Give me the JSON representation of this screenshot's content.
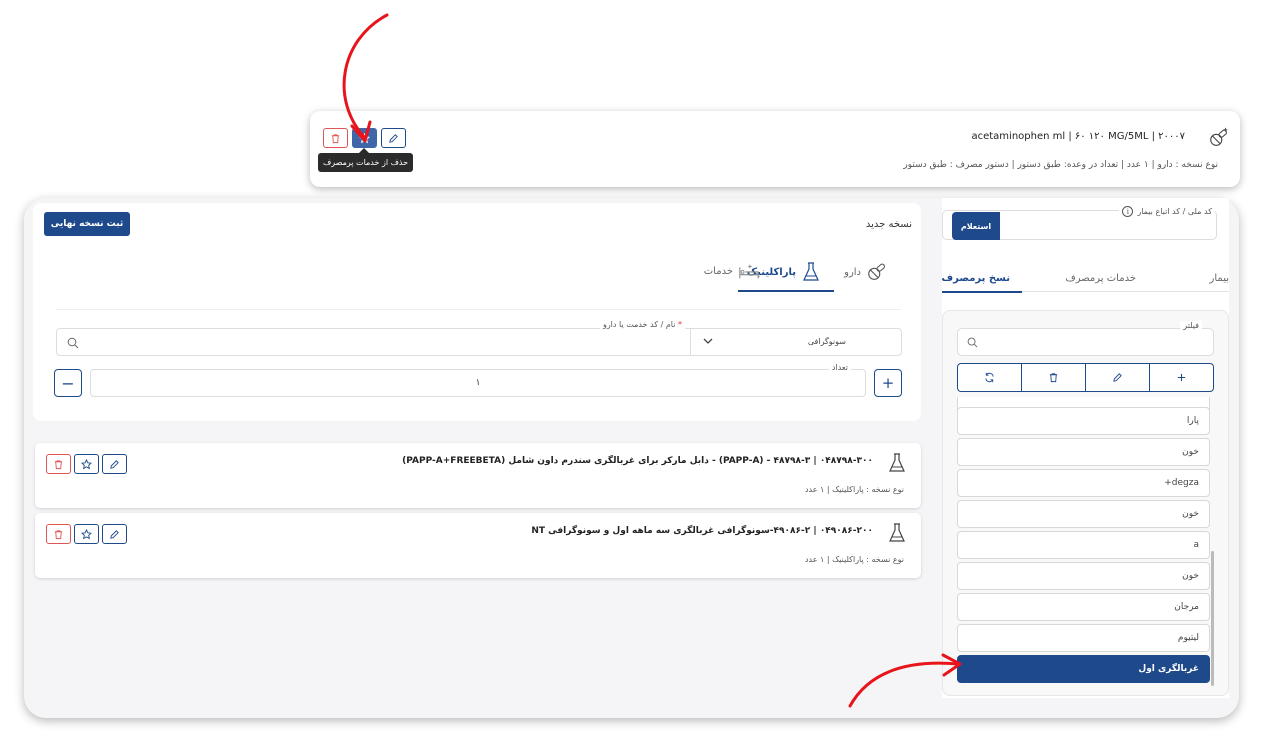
{
  "top_card": {
    "line1": "۲۰۰۰۷ | acetaminophen ml | ۶۰ ۱۲۰ MG/5ML",
    "line2": "نوع نسخه : دارو  |  ۱ عدد  |  تعداد در وعده: طبق دستور  |  دستور مصرف : طبق دستور",
    "tooltip": "حذف از خدمات پرمصرف"
  },
  "prescription": {
    "title": "نسخه جدید",
    "submit": "ثبت نسخه نهایی",
    "tabs": [
      "دارو",
      "پاراکلینیک",
      "خدمات"
    ],
    "active_tab": "پاراکلینیک",
    "search_label": "نام / کد خدمت یا دارو",
    "required_mark": "*",
    "select_value": "سونوگرافی",
    "qty_label": "تعداد",
    "qty_value": "۱",
    "qty_minus": "−",
    "qty_plus": "+"
  },
  "items": [
    {
      "line1": "۰۴۸۷۹۸-۳۰۰ | ۴۸۷۹۸-۳ - (PAPP-A) - دابل مارکر برای غربالگری سندرم داون شامل (PAPP-A+FREEBETA)",
      "line2": "نوع نسخه : پاراکلینیک  |  ۱ عدد"
    },
    {
      "line1": "۰۴۹۰۸۶-۲۰۰ | ۴۹۰۸۶-۲-سونوگرافی غربالگری سه ماهه اول و سونوگرافی NT",
      "line2": "نوع نسخه : پاراکلینیک  |  ۱ عدد"
    }
  ],
  "sidebar": {
    "inquiry_label": "کد ملی / کد اتباع بیمار",
    "inquiry_button": "استعلام",
    "tabs": [
      "بیمار",
      "خدمات پرمصرف",
      "نسخ پرمصرف"
    ],
    "active_tab": "نسخ پرمصرف",
    "filter_label": "فیلتر",
    "list": [
      "پارا",
      "خون",
      "degza+",
      "خون",
      "a",
      "خون",
      "مرجان",
      "لیتیوم",
      "غربالگری اول"
    ],
    "selected": "غربالگری اول"
  },
  "colors": {
    "primary": "#1e4a8c",
    "danger": "#e05555",
    "arrow": "#e8141b"
  }
}
